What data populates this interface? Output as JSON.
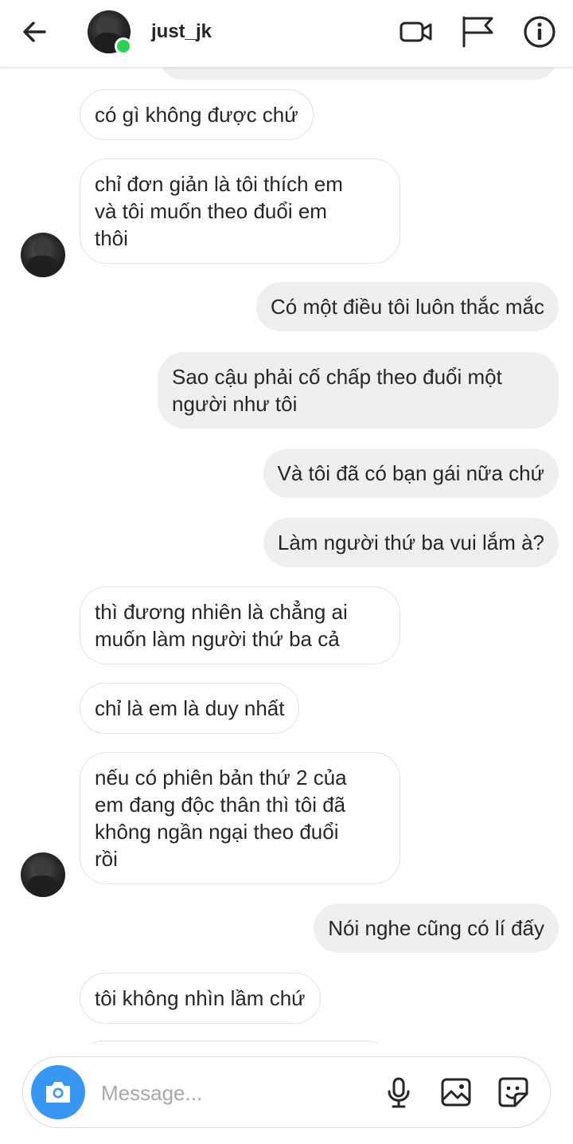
{
  "header": {
    "username": "just_jk",
    "online": true
  },
  "messages": [
    {
      "side": "out",
      "text": ""
    },
    {
      "side": "in",
      "text": "có gì không được chứ"
    },
    {
      "side": "in",
      "text": "chỉ đơn giản là tôi thích em\nvà tôi muốn theo đuổi em\nthôi"
    },
    {
      "side": "out",
      "text": "Có một điều tôi luôn thắc mắc"
    },
    {
      "side": "out",
      "text": "Sao cậu phải cố chấp theo đuổi một\nngười như tôi"
    },
    {
      "side": "out",
      "text": "Và tôi đã có bạn gái nữa chứ"
    },
    {
      "side": "out",
      "text": "Làm người thứ ba vui lắm à?"
    },
    {
      "side": "in",
      "text": "thì đương nhiên là chẳng ai\nmuốn làm người thứ ba cả"
    },
    {
      "side": "in",
      "text": "chỉ là em là duy nhất"
    },
    {
      "side": "in",
      "text": "nếu có phiên bản thứ 2 của\nem đang độc thân thì tôi đã\nkhông ngần ngại theo đuổi\nrồi"
    },
    {
      "side": "out",
      "text": "Nói nghe cũng có lí đấy"
    },
    {
      "side": "in",
      "text": "tôi không nhìn lầm chứ"
    },
    {
      "side": "in",
      "text": ""
    }
  ],
  "composer": {
    "placeholder": "Message..."
  },
  "icons": {
    "back": "arrow-left-icon",
    "video": "video-camera-icon",
    "report": "flag-icon",
    "info": "info-icon",
    "camera": "camera-icon",
    "mic": "microphone-icon",
    "gallery": "image-icon",
    "sticker": "sticker-icon"
  },
  "colors": {
    "accent": "#3897f0",
    "online": "#2bd258",
    "outgoing_bubble": "#efefef",
    "incoming_border": "#e3e3e3"
  }
}
